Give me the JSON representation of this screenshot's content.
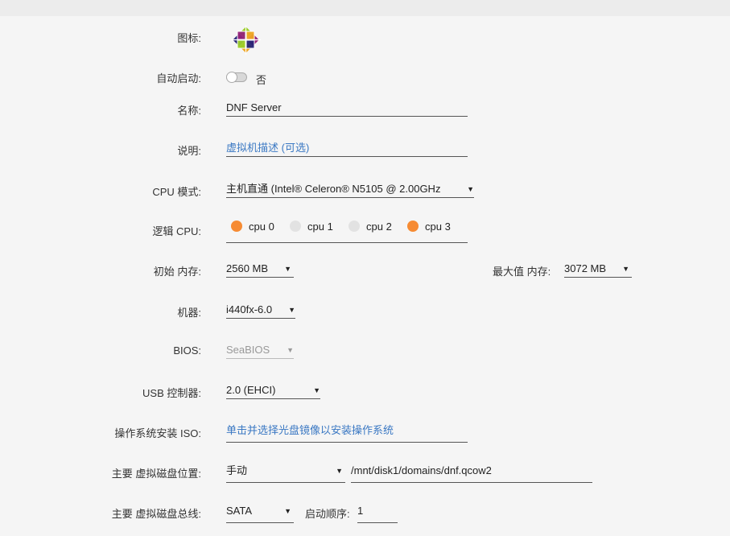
{
  "colors": {
    "accent_orange": "#f68b33",
    "link_blue": "#3a78c3",
    "panel_bg": "#f5f5f5"
  },
  "icon": {
    "label": "图标:",
    "name": "centos-logo-icon"
  },
  "autostart": {
    "label": "自动启动:",
    "value_text": "否",
    "on": false
  },
  "name": {
    "label": "名称:",
    "value": "DNF Server"
  },
  "description": {
    "label": "说明:",
    "placeholder": "虚拟机描述 (可选)"
  },
  "cpu_mode": {
    "label": "CPU 模式:",
    "value": "主机直通 (Intel® Celeron® N5105 @ 2.00GHz"
  },
  "logical_cpu": {
    "label": "逻辑 CPU:",
    "items": [
      {
        "label": "cpu 0",
        "selected": true
      },
      {
        "label": "cpu 1",
        "selected": false
      },
      {
        "label": "cpu 2",
        "selected": false
      },
      {
        "label": "cpu 3",
        "selected": true
      }
    ]
  },
  "initial_memory": {
    "label": "初始 内存:",
    "value": "2560 MB"
  },
  "max_memory": {
    "label": "最大值 内存:",
    "value": "3072 MB"
  },
  "machine": {
    "label": "机器:",
    "value": "i440fx-6.0"
  },
  "bios": {
    "label": "BIOS:",
    "value": "SeaBIOS"
  },
  "usb_controller": {
    "label": "USB 控制器:",
    "value": "2.0 (EHCI)"
  },
  "os_iso": {
    "label": "操作系统安装 ISO:",
    "placeholder": "单击并选择光盘镜像以安装操作系统"
  },
  "primary_disk_location": {
    "label": "主要 虚拟磁盘位置:",
    "mode": "手动",
    "path": "/mnt/disk1/domains/dnf.qcow2"
  },
  "primary_disk_bus": {
    "label": "主要 虚拟磁盘总线:",
    "value": "SATA",
    "boot_order_label": "启动顺序:",
    "boot_order": "1"
  },
  "arrow_glyph": "▼"
}
